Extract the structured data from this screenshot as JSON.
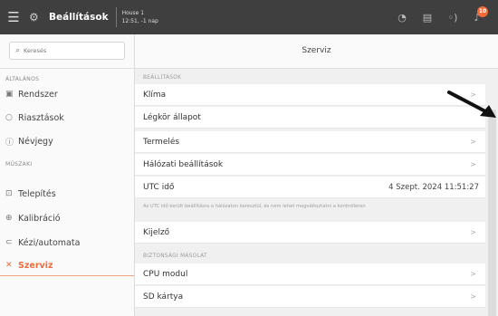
{
  "topbar": {
    "title": "Beállítások",
    "house_name": "House 1",
    "house_time": "12:51, -1 nap",
    "badge_count": "10",
    "icons": [
      "menu-icon",
      "gear-icon",
      "gauge-icon",
      "sd-card-icon",
      "signal-icon",
      "bell-icon"
    ]
  },
  "sidebar": {
    "search_placeholder": "Keresés",
    "section_general": "ÁLTALÁNOS",
    "section_technical": "MŰSZAKI",
    "items": [
      {
        "label": "Rendszer",
        "icon": "system-icon"
      },
      {
        "label": "Riasztások",
        "icon": "alarm-icon"
      },
      {
        "label": "Névjegy",
        "icon": "info-icon"
      },
      {
        "label": "Telepítés",
        "icon": "install-icon"
      },
      {
        "label": "Kalibráció",
        "icon": "calibration-icon"
      },
      {
        "label": "Kézi/automata",
        "icon": "manual-auto-icon"
      },
      {
        "label": "Szerviz",
        "icon": "wrench-icon",
        "active": true
      }
    ]
  },
  "main": {
    "header": "Szerviz",
    "section_settings": "BEÁLLÍTÁSOK",
    "section_backup": "BIZTONSÁGI MÁSOLAT",
    "rows": {
      "klima": "Klíma",
      "legkor": "Légkör állapot",
      "termeles": "Termelés",
      "halozati": "Hálózati beállítások",
      "utc_label": "UTC idő",
      "utc_value": "4 Szept. 2024 11:51:27",
      "kijelzo": "Kijelző",
      "cpu": "CPU modul",
      "sd": "SD kártya"
    },
    "utc_note": "Az UTC idő került beállításra a hálózaton keresztül, és nem lehet megváltoztatni a kontrolleren"
  },
  "colors": {
    "accent": "#f26b3a",
    "topbar": "#3f3f3f"
  }
}
